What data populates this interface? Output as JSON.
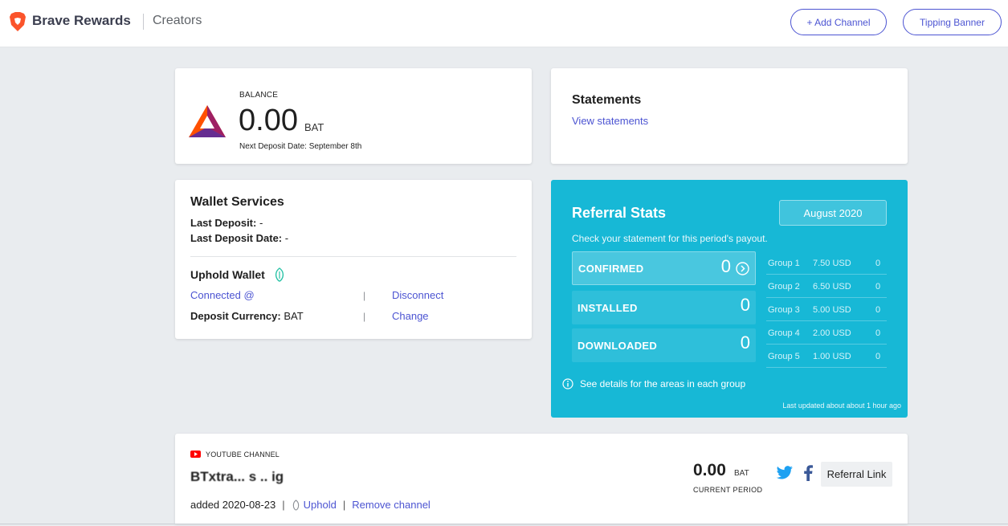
{
  "header": {
    "brand": "Brave Rewards",
    "section": "Creators",
    "add_channel": "+ Add Channel",
    "tipping_banner": "Tipping Banner"
  },
  "balance": {
    "label": "BALANCE",
    "value": "0.00",
    "unit": "BAT",
    "next_deposit": "Next Deposit Date: September 8th"
  },
  "statements": {
    "title": "Statements",
    "link": "View statements"
  },
  "wallet": {
    "title": "Wallet Services",
    "last_deposit_label": "Last Deposit:",
    "last_deposit_value": "-",
    "last_deposit_date_label": "Last Deposit Date:",
    "last_deposit_date_value": "-",
    "uphold_title": "Uphold Wallet",
    "connected_text": "Connected",
    "connected_at": "@",
    "disconnect": "Disconnect",
    "currency_label": "Deposit Currency:",
    "currency_value": "BAT",
    "change": "Change",
    "sep": "|"
  },
  "referral": {
    "title": "Referral Stats",
    "month": "August 2020",
    "description": "Check your statement for this period's payout.",
    "stats": [
      {
        "label": "CONFIRMED",
        "value": "0"
      },
      {
        "label": "INSTALLED",
        "value": "0"
      },
      {
        "label": "DOWNLOADED",
        "value": "0"
      }
    ],
    "groups": [
      {
        "name": "Group 1",
        "amount": "7.50 USD",
        "count": "0"
      },
      {
        "name": "Group 2",
        "amount": "6.50 USD",
        "count": "0"
      },
      {
        "name": "Group 3",
        "amount": "5.00 USD",
        "count": "0"
      },
      {
        "name": "Group 4",
        "amount": "2.00 USD",
        "count": "0"
      },
      {
        "name": "Group 5",
        "amount": "1.00 USD",
        "count": "0"
      }
    ],
    "details_link": "See details for the areas in each group",
    "updated": "Last updated about about 1 hour ago"
  },
  "channel": {
    "type_label": "YOUTUBE CHANNEL",
    "name": "BTxtra... s .. ig",
    "added": "added 2020-08-23",
    "sep": "|",
    "uphold": "Uphold",
    "remove": "Remove channel",
    "balance": "0.00",
    "unit": "BAT",
    "period": "CURRENT PERIOD",
    "referral_link": "Referral Link"
  },
  "colors": {
    "accent": "#4c54d2",
    "referral_bg": "#17b8d6",
    "brave_orange": "#fb542b",
    "twitter": "#1da1f2",
    "facebook": "#3b5998",
    "youtube": "#ff0000"
  }
}
